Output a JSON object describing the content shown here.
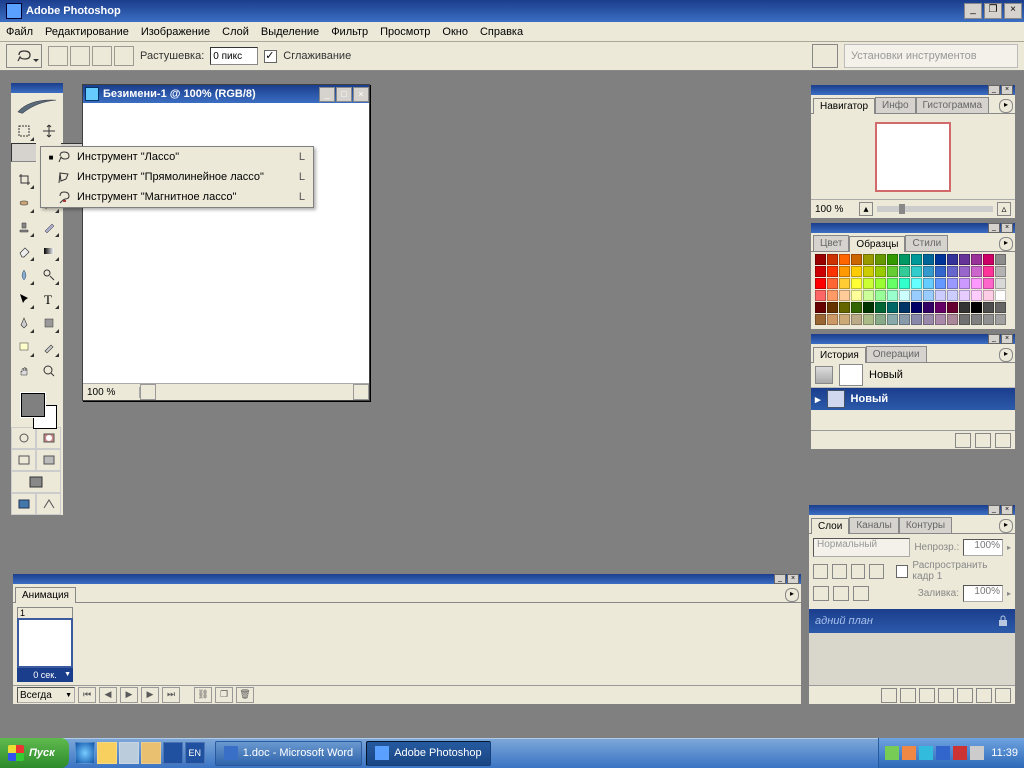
{
  "title": "Adobe Photoshop",
  "menus": [
    "Файл",
    "Редактирование",
    "Изображение",
    "Слой",
    "Выделение",
    "Фильтр",
    "Просмотр",
    "Окно",
    "Справка"
  ],
  "optbar": {
    "feather": "Растушевка:",
    "featherval": "0 пикс",
    "aa": "Сглаживание",
    "presets": "Установки инструментов"
  },
  "doc": {
    "title": "Безимени-1 @ 100% (RGB/8)",
    "zoom": "100 %"
  },
  "flyout": [
    {
      "name": "Инструмент \"Лассо\"",
      "key": "L",
      "sel": true
    },
    {
      "name": "Инструмент \"Прямолинейное лассо\"",
      "key": "L",
      "sel": false
    },
    {
      "name": "Инструмент \"Магнитное лассо\"",
      "key": "L",
      "sel": false
    }
  ],
  "nav": {
    "tabs": [
      "Навигатор",
      "Инфо",
      "Гистограмма"
    ],
    "zoom": "100 %"
  },
  "swatch": {
    "tabs": [
      "Цвет",
      "Образцы",
      "Стили"
    ]
  },
  "history": {
    "tabs": [
      "История",
      "Операции"
    ],
    "root": "Новый",
    "step": "Новый"
  },
  "layers": {
    "tabs": [
      "Слои",
      "Каналы",
      "Контуры"
    ],
    "mode": "Нормальный",
    "op_lbl": "Непрозр.:",
    "op_val": "100%",
    "prop": "Распространить кадр 1",
    "fill_lbl": "Заливка:",
    "fill_val": "100%",
    "bglayer": "адний план"
  },
  "anim": {
    "tab": "Анимация",
    "num": "1",
    "time": "0 сек.",
    "loop": "Всегда"
  },
  "taskbar": {
    "start": "Пуск",
    "doc": "1.doc - Microsoft Word",
    "ps": "Adobe Photoshop",
    "time": "11:39"
  },
  "swatches": [
    "#990000",
    "#cc3300",
    "#ff6600",
    "#cc6600",
    "#999900",
    "#669900",
    "#339900",
    "#009966",
    "#009999",
    "#006699",
    "#003399",
    "#333399",
    "#663399",
    "#993399",
    "#cc0066",
    "#8c8c8c",
    "#cc0000",
    "#ff3300",
    "#ff9900",
    "#ffcc00",
    "#cccc00",
    "#99cc00",
    "#66cc33",
    "#33cc99",
    "#33cccc",
    "#3399cc",
    "#3366cc",
    "#6666cc",
    "#9966cc",
    "#cc66cc",
    "#ff3399",
    "#b3b3b3",
    "#ff0000",
    "#ff6633",
    "#ffcc33",
    "#ffff33",
    "#ccff33",
    "#99ff33",
    "#66ff66",
    "#33ffcc",
    "#66ffff",
    "#66ccff",
    "#6699ff",
    "#9999ff",
    "#cc99ff",
    "#ff99ff",
    "#ff66cc",
    "#d9d9d9",
    "#ff6666",
    "#ff9966",
    "#ffcc99",
    "#ffff99",
    "#ccff99",
    "#99ff99",
    "#99ffcc",
    "#ccffff",
    "#99ccff",
    "#99ccff",
    "#ccccff",
    "#ccccff",
    "#e6ccff",
    "#ffccff",
    "#ffcce6",
    "#ffffff",
    "#660000",
    "#663300",
    "#666600",
    "#336600",
    "#003300",
    "#006633",
    "#006666",
    "#003366",
    "#000066",
    "#330066",
    "#660066",
    "#660033",
    "#333333",
    "#000000",
    "#4d4d4d",
    "#666666",
    "#996633",
    "#cc9966",
    "#ccaa77",
    "#bbaa88",
    "#aabb88",
    "#88aa88",
    "#88aaaa",
    "#8899aa",
    "#8888aa",
    "#9988aa",
    "#aa88aa",
    "#aa8899",
    "#707070",
    "#808080",
    "#909090",
    "#a0a0a0"
  ]
}
